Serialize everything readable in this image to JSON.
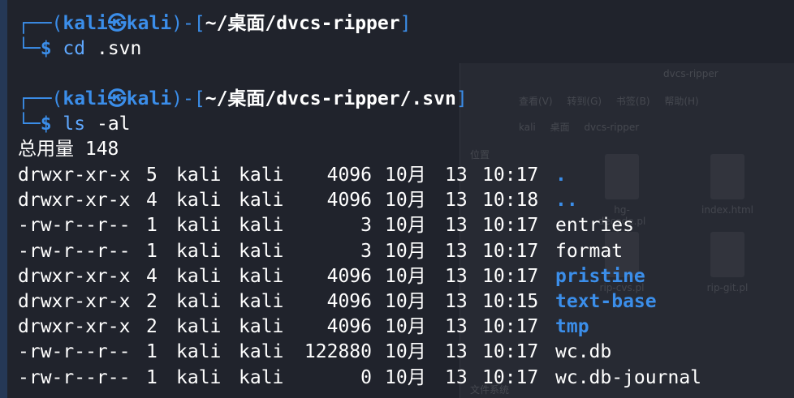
{
  "background_window": {
    "title": "dvcs-ripper",
    "menu": [
      "查看(V)",
      "转到(G)",
      "书签(B)",
      "帮助(H)"
    ],
    "path": [
      "kali",
      "桌面",
      "dvcs-ripper"
    ],
    "sidebar_heading": "位置",
    "sidebar_bottom": "文件系统",
    "files": [
      {
        "name": "hg-decode.pl"
      },
      {
        "name": "index.html"
      },
      {
        "name": "rip-cvs.pl"
      },
      {
        "name": "rip-git.pl"
      }
    ]
  },
  "prompts": [
    {
      "user": "kali",
      "at_symbol": "㉿",
      "host": "kali",
      "cwd": "~/桌面/dvcs-ripper",
      "command": "cd",
      "argument": ".svn"
    },
    {
      "user": "kali",
      "at_symbol": "㉿",
      "host": "kali",
      "cwd": "~/桌面/dvcs-ripper/.svn",
      "command": "ls",
      "argument": "-al"
    }
  ],
  "listing": {
    "total": "总用量 148",
    "rows": [
      {
        "perms": "drwxr-xr-x",
        "links": "5",
        "owner": "kali",
        "group": "kali",
        "size": "4096",
        "month": "10月",
        "day": "13",
        "time": "10:17",
        "name": ".",
        "type": "dir"
      },
      {
        "perms": "drwxr-xr-x",
        "links": "4",
        "owner": "kali",
        "group": "kali",
        "size": "4096",
        "month": "10月",
        "day": "13",
        "time": "10:18",
        "name": "..",
        "type": "dir"
      },
      {
        "perms": "-rw-r--r--",
        "links": "1",
        "owner": "kali",
        "group": "kali",
        "size": "3",
        "month": "10月",
        "day": "13",
        "time": "10:17",
        "name": "entries",
        "type": "file"
      },
      {
        "perms": "-rw-r--r--",
        "links": "1",
        "owner": "kali",
        "group": "kali",
        "size": "3",
        "month": "10月",
        "day": "13",
        "time": "10:17",
        "name": "format",
        "type": "file"
      },
      {
        "perms": "drwxr-xr-x",
        "links": "4",
        "owner": "kali",
        "group": "kali",
        "size": "4096",
        "month": "10月",
        "day": "13",
        "time": "10:17",
        "name": "pristine",
        "type": "dir"
      },
      {
        "perms": "drwxr-xr-x",
        "links": "2",
        "owner": "kali",
        "group": "kali",
        "size": "4096",
        "month": "10月",
        "day": "13",
        "time": "10:15",
        "name": "text-base",
        "type": "dir"
      },
      {
        "perms": "drwxr-xr-x",
        "links": "2",
        "owner": "kali",
        "group": "kali",
        "size": "4096",
        "month": "10月",
        "day": "13",
        "time": "10:17",
        "name": "tmp",
        "type": "dir"
      },
      {
        "perms": "-rw-r--r--",
        "links": "1",
        "owner": "kali",
        "group": "kali",
        "size": "122880",
        "month": "10月",
        "day": "13",
        "time": "10:17",
        "name": "wc.db",
        "type": "file"
      },
      {
        "perms": "-rw-r--r--",
        "links": "1",
        "owner": "kali",
        "group": "kali",
        "size": "0",
        "month": "10月",
        "day": "13",
        "time": "10:17",
        "name": "wc.db-journal",
        "type": "file"
      }
    ]
  },
  "colors": {
    "background": "#20232c",
    "prompt_blue": "#3b8eea",
    "command_blue": "#5fa8ff",
    "directory_blue": "#3b8eea",
    "text": "#ffffff"
  }
}
